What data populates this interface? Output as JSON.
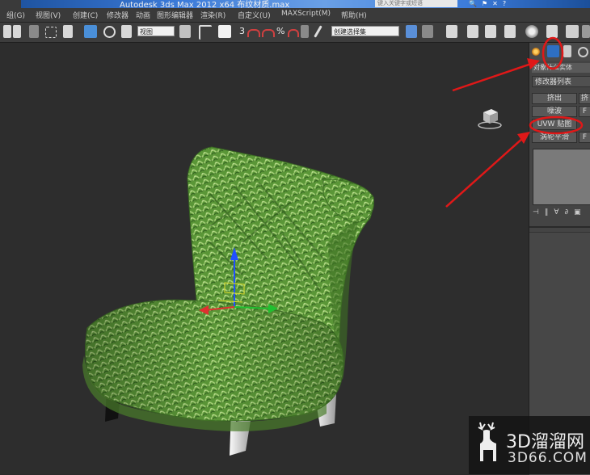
{
  "app": {
    "title": "Autodesk 3ds Max  2012 x64   布纹材质.max",
    "search_placeholder": "键入关键字或短语"
  },
  "menu": [
    "组(G)",
    "视图(V)",
    "创建(C)",
    "修改器",
    "动画",
    "图形编辑器",
    "渲染(R)",
    "自定义(U)",
    "MAXScript(M)",
    "帮助(H)"
  ],
  "toolbar": {
    "view_dropdown": "视图",
    "selection_set_dropdown": "创建选择集",
    "snap_label": "3"
  },
  "command_panel": {
    "object_name": "对象什么实体",
    "modifier_list": "修改器列表",
    "buttons": {
      "extrude": "挤出",
      "noise": "噪波",
      "uvw_map": "UVW 贴图",
      "turbosmooth": "涡轮平滑",
      "f1": "挤",
      "f2": "F",
      "f3": "F"
    }
  },
  "watermark": {
    "brand": "3D溜溜网",
    "url": "3D66.COM"
  },
  "colors": {
    "viewport_bg": "#2d2d2d",
    "fabric_green": "#5f9c3a",
    "annotation_red": "#e01818",
    "accent_blue": "#4a8fd8"
  }
}
